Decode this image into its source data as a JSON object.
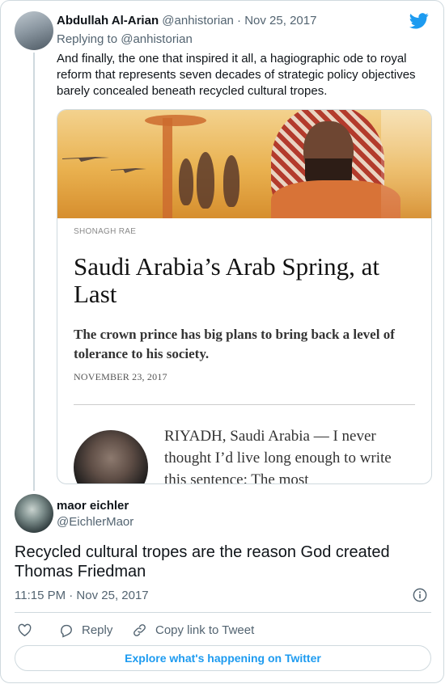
{
  "colors": {
    "twitter_blue": "#1d9bf0",
    "text": "#0f1419",
    "muted": "#536471",
    "border": "#cfd9de"
  },
  "tweet1": {
    "name": "Abdullah Al-Arian",
    "handle": "@anhistorian · Nov 25, 2017",
    "reply_prefix": "Replying to",
    "reply_handle": "@anhistorian",
    "text": "And finally, the one that inspired it all, a hagiographic ode to royal reform that represents seven decades of strategic policy objectives barely concealed beneath recycled cultural tropes.",
    "embed": {
      "credit": "SHONAGH RAE",
      "headline": "Saudi Arabia’s Arab Spring, at Last",
      "dek": "The crown prince has big plans to bring back a level of tolerance to his society.",
      "date": "NOVEMBER 23, 2017",
      "lead": "RIYADH, Saudi Arabia — I never thought I’d live long enough to write this sentence: The most"
    }
  },
  "tweet2": {
    "name": "maor eichler",
    "handle": "@EichlerMaor",
    "text": "Recycled cultural tropes are the reason God created Thomas Friedman",
    "timestamp": "11:15 PM · Nov 25, 2017"
  },
  "actions": {
    "reply": "Reply",
    "copy_link": "Copy link to Tweet"
  },
  "explore_label": "Explore what's happening on Twitter",
  "icons": [
    "twitter-bird-icon",
    "info-icon",
    "heart-icon",
    "reply-icon",
    "link-icon"
  ]
}
